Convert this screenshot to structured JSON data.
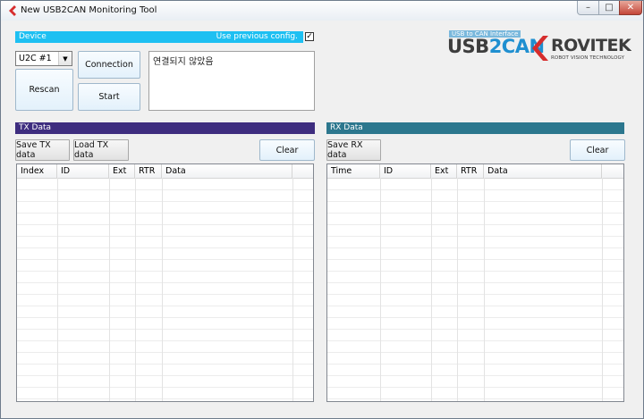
{
  "window": {
    "title": "New USB2CAN Monitoring Tool",
    "minimize_glyph": "–",
    "maximize_glyph": "□",
    "close_glyph": "✕"
  },
  "device": {
    "header_label": "Device",
    "use_prev_label": "Use previous config.",
    "use_prev_checked": true,
    "check_glyph": "✓",
    "selected_device": "U2C #1",
    "connection_label": "Connection",
    "rescan_label": "Rescan",
    "start_label": "Start",
    "status_text": "연결되지 않았음"
  },
  "logo": {
    "tagline": "USB to CAN Interface",
    "product_a": "USB",
    "product_b": "2CAN",
    "brand": "ROVITEK",
    "brand_sub": "ROBOT VISION TECHNOLOGY"
  },
  "tx": {
    "header_label": "TX Data",
    "save_label": "Save TX data",
    "load_label": "Load TX data",
    "clear_label": "Clear",
    "columns": [
      "Index",
      "ID",
      "Ext",
      "RTR",
      "Data"
    ]
  },
  "rx": {
    "header_label": "RX Data",
    "save_label": "Save RX data",
    "clear_label": "Clear",
    "columns": [
      "Time",
      "ID",
      "Ext",
      "RTR",
      "Data"
    ]
  },
  "colors": {
    "device_bar": "#1ec0f2",
    "tx_bar": "#3e2d7f",
    "rx_bar": "#2c778e",
    "logo_blue": "#1f8fd0",
    "logo_red": "#d62d2d",
    "logo_dark": "#3d3d3d"
  }
}
